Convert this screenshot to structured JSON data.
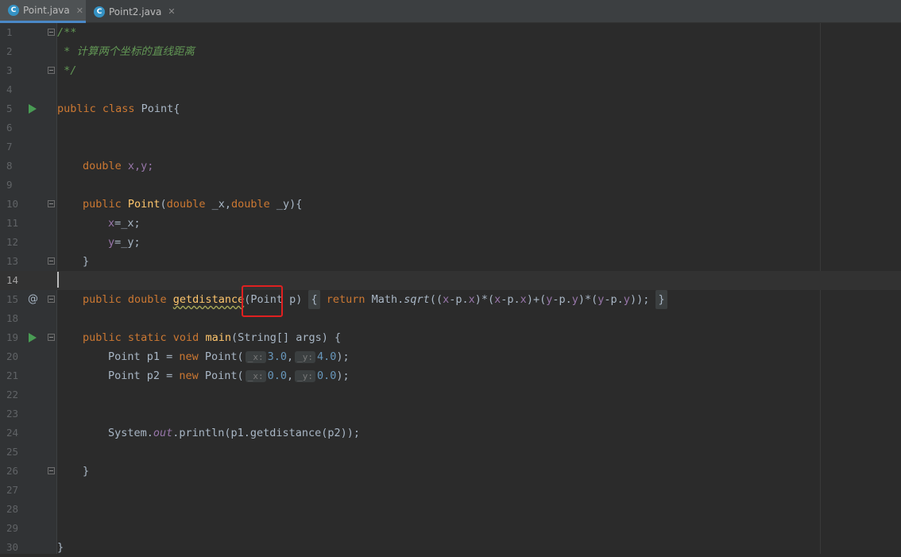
{
  "tabs": [
    {
      "label": "Point.java",
      "icon": "C",
      "active": true
    },
    {
      "label": "Point2.java",
      "icon": "C",
      "active": false
    }
  ],
  "editor": {
    "line_numbers": [
      "1",
      "2",
      "3",
      "4",
      "5",
      "6",
      "7",
      "8",
      "9",
      "10",
      "11",
      "12",
      "13",
      "14",
      "15",
      "18",
      "19",
      "20",
      "21",
      "22",
      "23",
      "24",
      "25",
      "26",
      "27",
      "28",
      "29",
      "30"
    ],
    "current_line": "14",
    "code": {
      "l1": "/**",
      "l2": " * 计算两个坐标的直线距离",
      "l3": " */",
      "l5_kw": "public class ",
      "l5_rest": "Point{",
      "l8_kw": "double ",
      "l8_rest": "x,y;",
      "l10_kw1": "public ",
      "l10_fn": "Point",
      "l10_p1": "(",
      "l10_kw2": "double ",
      "l10_p2": "_x,",
      "l10_kw3": "double ",
      "l10_p3": "_y){",
      "l11_f": "x",
      "l11_rest": "=_x;",
      "l12_f": "y",
      "l12_rest": "=_y;",
      "l13": "}",
      "l15_kw": "public double ",
      "l15_fn": "getdistance",
      "l15_a": "(Point p) ",
      "l15_ob": "{",
      "l15_ret": " return ",
      "l15_b": "Math.",
      "l15_sqrt": "sqrt",
      "l15_c1": "((",
      "l15_x1": "x",
      "l15_c2": "-p.",
      "l15_x2": "x",
      "l15_c3": ")*(",
      "l15_x3": "x",
      "l15_c4": "-p.",
      "l15_x4": "x",
      "l15_c5": ")+(",
      "l15_y1": "y",
      "l15_c6": "-p.",
      "l15_y2": "y",
      "l15_c7": ")*(",
      "l15_y3": "y",
      "l15_c8": "-p.",
      "l15_y4": "y",
      "l15_c9": "));",
      "l15_cb": "}",
      "l19_kw": "public static void ",
      "l19_fn": "main",
      "l19_rest": "(String[] args) {",
      "l20_a": "Point p1 = ",
      "l20_kw": "new ",
      "l20_b": "Point(",
      "l20_h1": "_x:",
      "l20_v1": "3.0",
      "l20_c": ",",
      "l20_h2": "_y:",
      "l20_v2": "4.0",
      "l20_e": ");",
      "l21_a": "Point p2 = ",
      "l21_kw": "new ",
      "l21_b": "Point(",
      "l21_h1": "_x:",
      "l21_v1": "0.0",
      "l21_c": ",",
      "l21_h2": "_y:",
      "l21_v2": "0.0",
      "l21_e": ");",
      "l24_a": "System.",
      "l24_out": "out",
      "l24_b": ".println(p1.getdistance(p2));",
      "l26": "}",
      "l30": "}"
    },
    "gutter_icons": {
      "run": "run-icon",
      "override": "@"
    }
  }
}
